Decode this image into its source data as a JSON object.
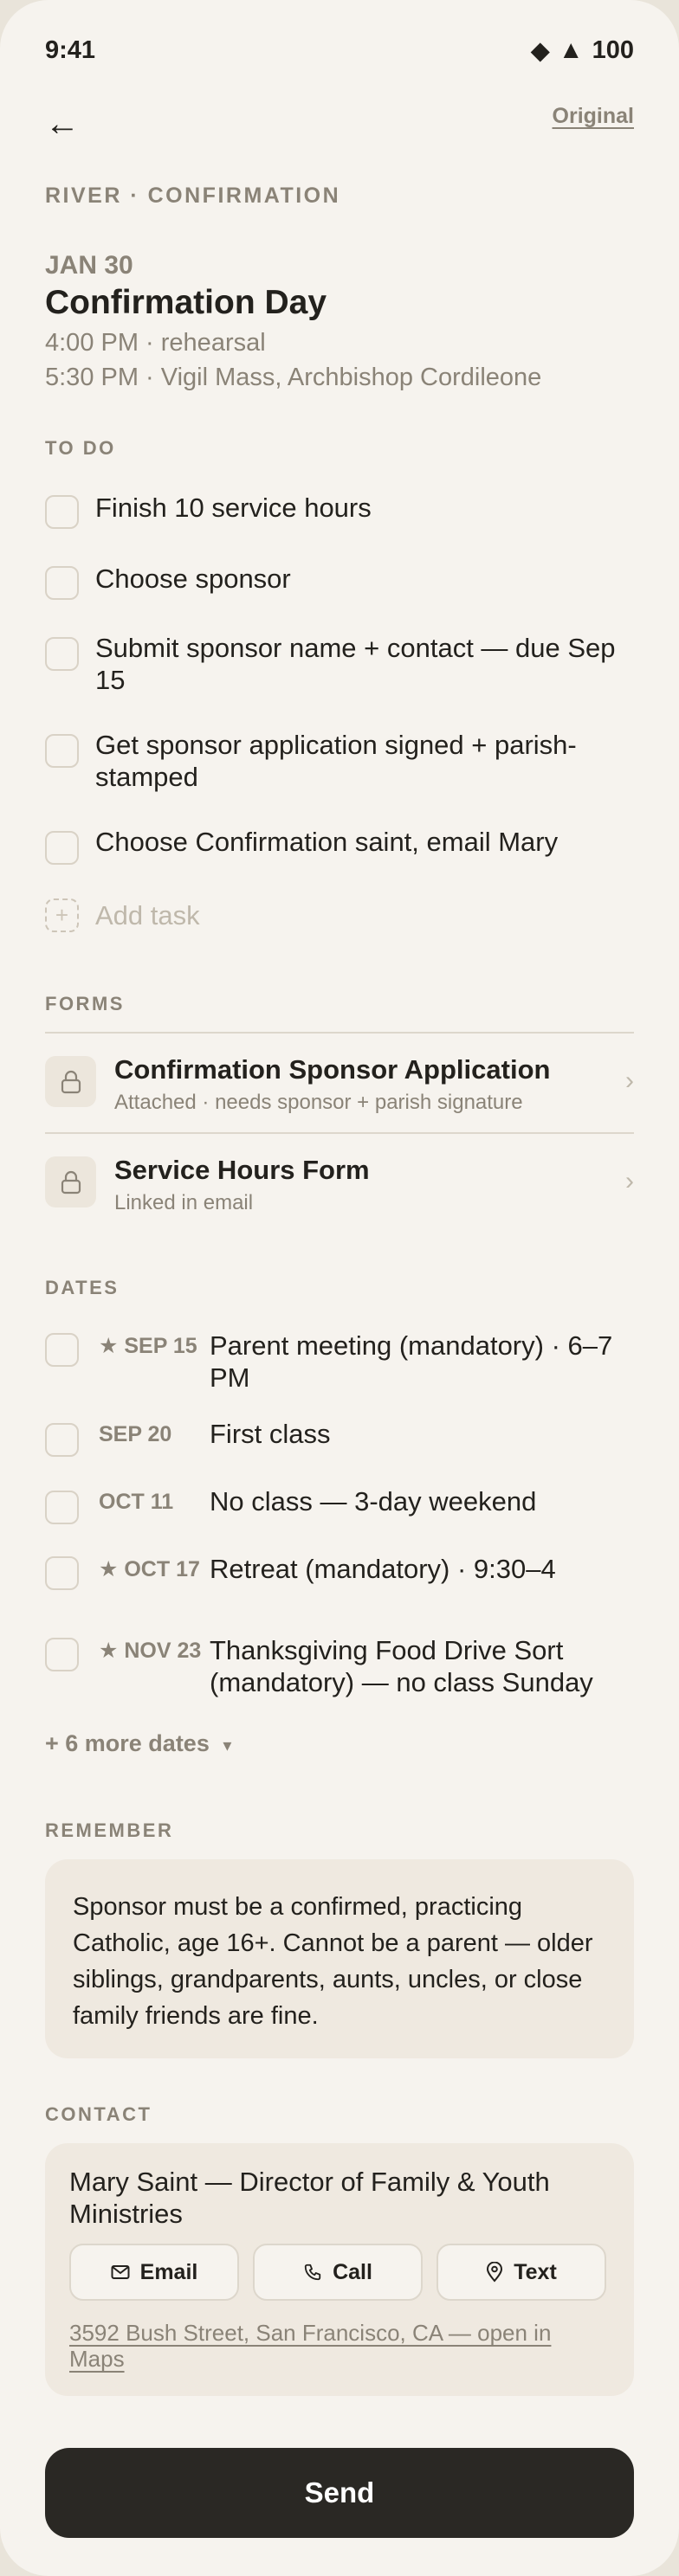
{
  "status": {
    "time": "9:41",
    "battery": "100"
  },
  "nav": {
    "back_glyph": "←",
    "original_label": "Original"
  },
  "breadcrumb": "RIVER · CONFIRMATION",
  "event": {
    "date": "JAN 30",
    "title": "Confirmation Day",
    "line1": "4:00 PM · rehearsal",
    "line2": "5:30 PM · Vigil Mass, Archbishop Cordileone"
  },
  "todo": {
    "heading": "TO DO",
    "items": [
      {
        "label": "Finish 10 service hours"
      },
      {
        "label": "Choose sponsor"
      },
      {
        "label": "Submit sponsor name + contact — due Sep 15"
      },
      {
        "label": "Get sponsor application signed + parish-stamped"
      },
      {
        "label": "Choose Confirmation saint, email Mary"
      }
    ],
    "add_label": "Add task"
  },
  "forms": {
    "heading": "FORMS",
    "items": [
      {
        "title": "Confirmation Sponsor Application",
        "meta": "Attached · needs sponsor + parish signature"
      },
      {
        "title": "Service Hours Form",
        "meta": "Linked in email"
      }
    ]
  },
  "dates": {
    "heading": "DATES",
    "items": [
      {
        "date": "★ SEP 15",
        "label": "Parent meeting (mandatory) · 6–7 PM"
      },
      {
        "date": "SEP 20",
        "label": "First class"
      },
      {
        "date": "OCT 11",
        "label": "No class — 3-day weekend"
      },
      {
        "date": "★ OCT 17",
        "label": "Retreat (mandatory) · 9:30–4"
      },
      {
        "date": "★ NOV 23",
        "label": "Thanksgiving Food Drive Sort (mandatory) — no class Sunday"
      }
    ],
    "more_label": "+ 6 more dates",
    "more_glyph": "▾"
  },
  "remember": {
    "heading": "REMEMBER",
    "text": "Sponsor must be a confirmed, practicing Catholic, age 16+. Cannot be a parent — older siblings, grandparents, aunts, uncles, or close family friends are fine."
  },
  "contact": {
    "heading": "CONTACT",
    "name": "Mary Saint — Director of Family & Youth Ministries",
    "email_label": "Email",
    "call_label": "Call",
    "text_label": "Text",
    "address": "3592 Bush Street, San Francisco, CA — open in Maps"
  },
  "send_label": "Send",
  "colors": {
    "background": "#f6f3ee",
    "muted": "#8a8377",
    "card": "#efe9e0",
    "primary_button": "#2a2824"
  }
}
